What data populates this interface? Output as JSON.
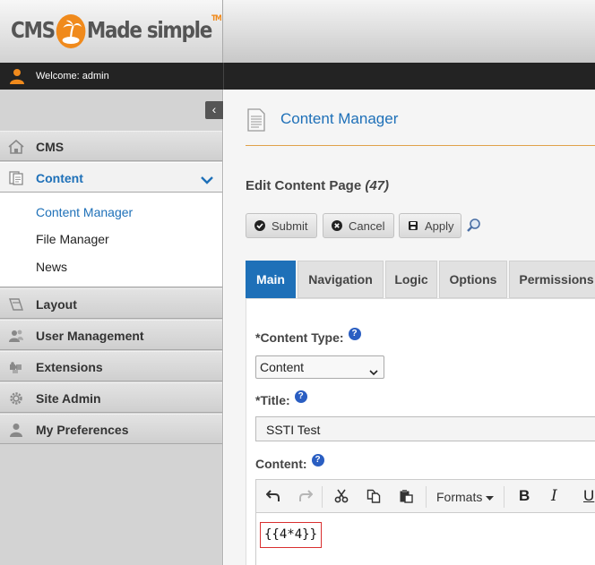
{
  "header": {
    "logo_left": "CMS",
    "logo_right": "Made simple",
    "logo_tm": "TM"
  },
  "welcome": {
    "text": "Welcome: admin"
  },
  "sidebar": {
    "collapse_glyph": "‹",
    "items": [
      {
        "label": "CMS",
        "icon": "home-icon"
      },
      {
        "label": "Content",
        "icon": "content-icon",
        "active": true
      },
      {
        "label": "Layout",
        "icon": "layout-icon"
      },
      {
        "label": "User Management",
        "icon": "users-icon"
      },
      {
        "label": "Extensions",
        "icon": "puzzle-icon"
      },
      {
        "label": "Site Admin",
        "icon": "gear-icon"
      },
      {
        "label": "My Preferences",
        "icon": "user-icon"
      }
    ],
    "submenu": [
      {
        "label": "Content Manager",
        "current": true
      },
      {
        "label": "File Manager"
      },
      {
        "label": "News"
      }
    ]
  },
  "main": {
    "heading": "Content Manager",
    "edit_title": "Edit Content Page",
    "edit_id": "(47)",
    "buttons": {
      "submit": "Submit",
      "cancel": "Cancel",
      "apply": "Apply"
    },
    "tabs": [
      {
        "label": "Main",
        "active": true
      },
      {
        "label": "Navigation"
      },
      {
        "label": "Logic"
      },
      {
        "label": "Options"
      },
      {
        "label": "Permissions"
      }
    ],
    "fields": {
      "content_type_label": "*Content Type:",
      "content_type_value": "Content",
      "title_label": "*Title:",
      "title_value": "SSTI Test",
      "content_label": "Content:",
      "help_glyph": "?"
    },
    "editor": {
      "formats_label": "Formats",
      "bold": "B",
      "italic": "I",
      "underline": "U",
      "content": "{{4*4}}"
    }
  },
  "colors": {
    "accent": "#1e70b8",
    "brand_orange": "#f08a1c",
    "highlight_border": "#d93030"
  }
}
